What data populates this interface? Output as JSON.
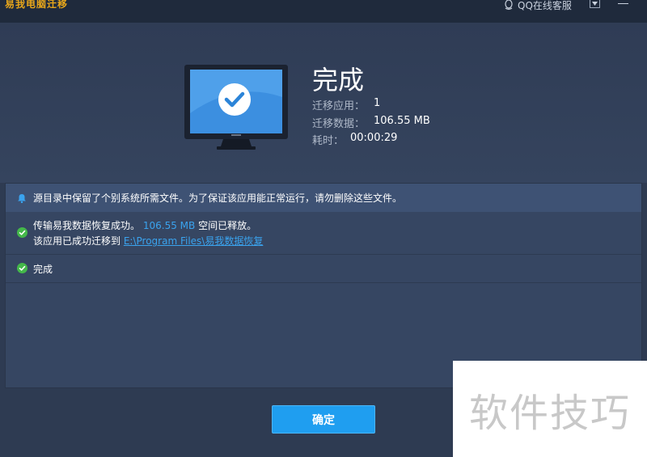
{
  "app": {
    "title": "易我电脑迁移"
  },
  "titlebar": {
    "support_label": "QQ在线客服"
  },
  "result": {
    "title": "完成",
    "stats": [
      {
        "label": "迁移应用：",
        "value": "1"
      },
      {
        "label": "迁移数据：",
        "value": "106.55 MB"
      },
      {
        "label": "耗时：",
        "value": "00:00:29"
      }
    ]
  },
  "notice": {
    "text": "源目录中保留了个别系统所需文件。为了保证该应用能正常运行，请勿删除这些文件。"
  },
  "log": {
    "row1": {
      "text_before": "传输易我数据恢复成功。",
      "size": "106.55 MB",
      "text_after": "空间已释放。",
      "line2_prefix": "该应用已成功迁移到",
      "path": "E:\\Program Files\\易我数据恢复"
    },
    "row2": {
      "text": "完成"
    }
  },
  "buttons": {
    "confirm": "确定"
  },
  "watermark": {
    "text": "软件技巧"
  },
  "colors": {
    "accent": "#1f9ef0",
    "success": "#44b84a",
    "title_orange": "#e7a61b",
    "background": "#2e3b52"
  }
}
